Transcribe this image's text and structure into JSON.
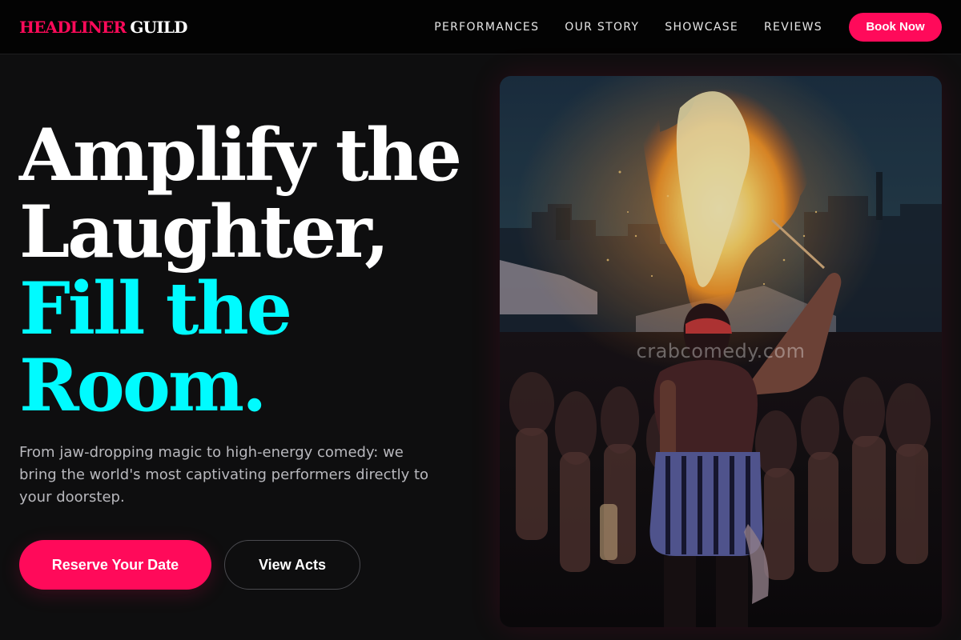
{
  "brand": {
    "accent_word": "HEADLINER",
    "rest_word": "GUILD",
    "accent_color": "#ff0a5a"
  },
  "nav": {
    "links": [
      {
        "label": "PERFORMANCES"
      },
      {
        "label": "OUR STORY"
      },
      {
        "label": "SHOWCASE"
      },
      {
        "label": "REVIEWS"
      }
    ],
    "cta_label": "Book Now"
  },
  "hero": {
    "headline_lines": [
      {
        "text": "Amplify the",
        "color": "white"
      },
      {
        "text": "Laughter,",
        "color": "white"
      },
      {
        "text": "Fill the",
        "color": "cyan"
      },
      {
        "text": "Room.",
        "color": "cyan"
      }
    ],
    "highlight_color": "#00fbff",
    "subtext": "From jaw-dropping magic to high-energy comedy: we bring the world's most captivating performers directly to your doorstep.",
    "primary_cta": "Reserve Your Date",
    "secondary_cta": "View Acts"
  },
  "image": {
    "icon": "fire-breather-photo",
    "watermark": "crabcomedy.com"
  }
}
